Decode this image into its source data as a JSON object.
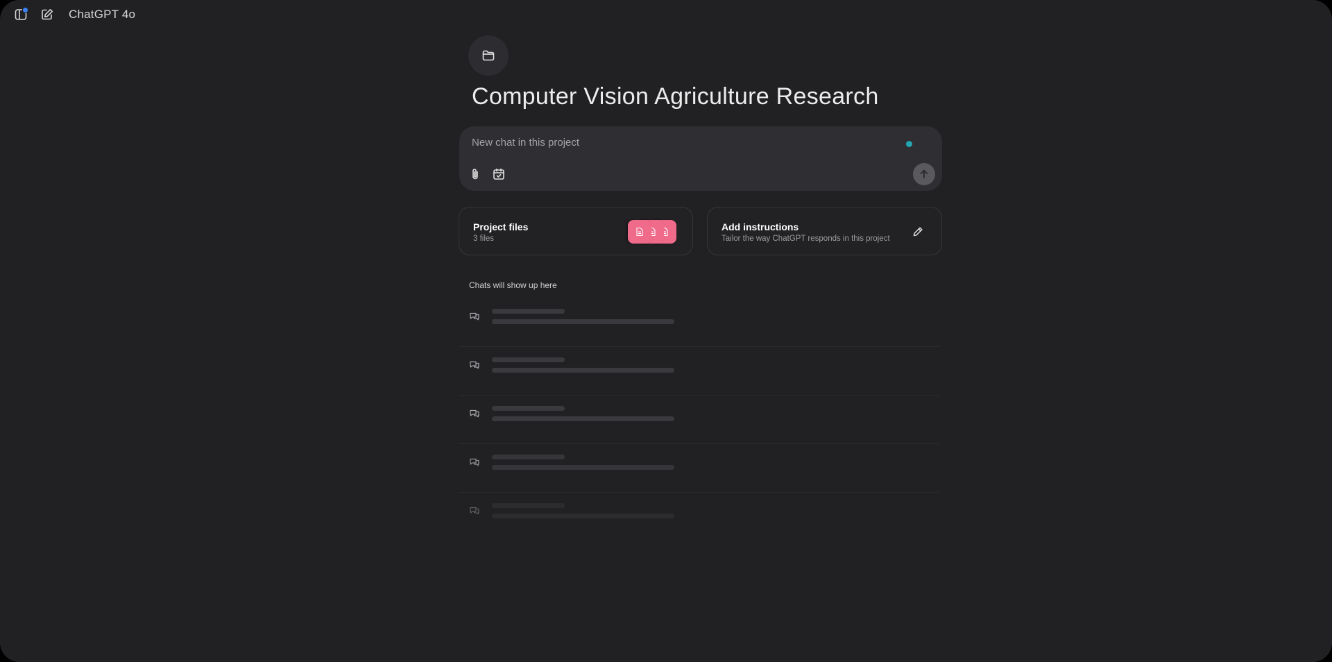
{
  "topbar": {
    "sidebar_icon": "sidebar-notification-icon",
    "new_chat_icon": "compose-icon",
    "model_name": "ChatGPT 4o"
  },
  "project": {
    "folder_icon": "folder-icon",
    "title": "Computer Vision Agriculture Research"
  },
  "composer": {
    "placeholder": "New chat in this project",
    "value": "",
    "status_dot_color": "#22a6b3",
    "attach_icon": "paperclip-icon",
    "schedule_icon": "calendar-check-icon",
    "send_icon": "arrow-up-icon"
  },
  "cards": {
    "files": {
      "title": "Project files",
      "subtitle": "3 files",
      "file_icon": "document-icon",
      "file_chip_color": "#f06a8a"
    },
    "instructions": {
      "title": "Add instructions",
      "subtitle": "Tailor the way ChatGPT responds in this project",
      "edit_icon": "pencil-icon"
    }
  },
  "chats": {
    "caption": "Chats will show up here",
    "placeholder_rows": [
      {
        "icon": "chat-bubbles-icon",
        "opacity": 1.0
      },
      {
        "icon": "chat-bubbles-icon",
        "opacity": 1.0
      },
      {
        "icon": "chat-bubbles-icon",
        "opacity": 1.0
      },
      {
        "icon": "chat-bubbles-icon",
        "opacity": 0.85
      },
      {
        "icon": "chat-bubbles-icon",
        "opacity": 0.45
      }
    ]
  }
}
